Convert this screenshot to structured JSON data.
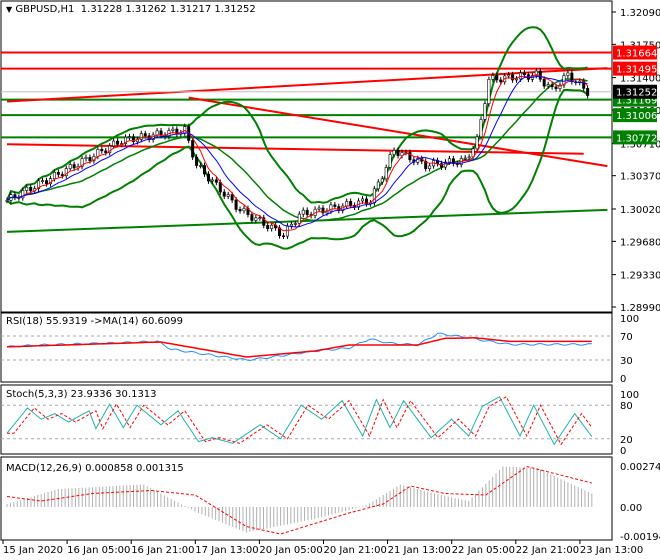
{
  "header": {
    "symbol": "GBPUSD,H1",
    "ohlc": "1.31228 1.31262 1.31217 1.31252"
  },
  "chart_data": {
    "type": "candlestick",
    "bars": 148,
    "price_axis": {
      "ticks": [
        "1.32090",
        "1.31750",
        "1.31400",
        "1.31060",
        "1.30710",
        "1.30370",
        "1.30020",
        "1.29680",
        "1.29330",
        "1.28990"
      ],
      "range": [
        1.2899,
        1.3209
      ]
    },
    "close_waypoints": [
      [
        0,
        1.3011
      ],
      [
        15,
        1.3043
      ],
      [
        29,
        1.3074
      ],
      [
        45,
        1.3085
      ],
      [
        48,
        1.3048
      ],
      [
        59,
        1.3001
      ],
      [
        70,
        1.2975
      ],
      [
        74,
        1.2996
      ],
      [
        92,
        1.3011
      ],
      [
        98,
        1.3064
      ],
      [
        106,
        1.3048
      ],
      [
        116,
        1.3053
      ],
      [
        119,
        1.3074
      ],
      [
        122,
        1.3138
      ],
      [
        134,
        1.3143
      ],
      [
        138,
        1.3127
      ],
      [
        142,
        1.3143
      ],
      [
        147,
        1.31252
      ]
    ],
    "levels": [
      {
        "price": "1.31664",
        "color": "#ff0000"
      },
      {
        "price": "1.31495",
        "color": "#ff0000"
      },
      {
        "price": "1.31169",
        "color": "#008000"
      },
      {
        "price": "1.31006",
        "color": "#008000"
      },
      {
        "price": "1.30772",
        "color": "#008000"
      }
    ],
    "current_price": "1.31252",
    "trendlines": [
      {
        "from": [
          0,
          1.3115
        ],
        "to": [
          152,
          1.315
        ],
        "color": "#ff0000"
      },
      {
        "from": [
          46,
          1.3119
        ],
        "to": [
          152,
          1.3047
        ],
        "color": "#ff0000"
      },
      {
        "from": [
          0,
          1.307
        ],
        "to": [
          146,
          1.306
        ],
        "color": "#ff0000"
      },
      {
        "from": [
          0,
          1.2978
        ],
        "to": [
          152,
          1.3001
        ],
        "color": "#008000"
      }
    ],
    "time_labels": [
      "15 Jan 2020",
      "16 Jan 05:00",
      "16 Jan 21:00",
      "17 Jan 13:00",
      "20 Jan 05:00",
      "20 Jan 21:00",
      "21 Jan 13:00",
      "22 Jan 05:00",
      "22 Jan 21:00",
      "23 Jan 13:00"
    ],
    "rsi": {
      "label": "RSI(18) 55.9319  ->MA(14) 60.6099",
      "ticks": [
        "100",
        "70",
        "30",
        "0"
      ],
      "waypoints": [
        [
          0,
          52
        ],
        [
          10,
          55
        ],
        [
          30,
          58
        ],
        [
          44,
          61
        ],
        [
          48,
          48
        ],
        [
          60,
          38
        ],
        [
          70,
          30
        ],
        [
          75,
          33
        ],
        [
          90,
          45
        ],
        [
          100,
          50
        ],
        [
          106,
          65
        ],
        [
          112,
          58
        ],
        [
          120,
          55
        ],
        [
          126,
          74
        ],
        [
          134,
          68
        ],
        [
          140,
          62
        ],
        [
          147,
          56
        ]
      ],
      "ma_waypoints": [
        [
          0,
          52
        ],
        [
          45,
          60
        ],
        [
          60,
          45
        ],
        [
          70,
          35
        ],
        [
          90,
          45
        ],
        [
          100,
          55
        ],
        [
          120,
          55
        ],
        [
          128,
          66
        ],
        [
          137,
          67
        ],
        [
          147,
          61
        ]
      ]
    },
    "stoch": {
      "label": "Stoch(5,3,3) 23.9336 30.1313",
      "ticks": [
        "100",
        "80",
        "20",
        "0"
      ],
      "waypoints": [
        [
          0,
          30
        ],
        [
          6,
          75
        ],
        [
          10,
          55
        ],
        [
          14,
          65
        ],
        [
          18,
          50
        ],
        [
          24,
          70
        ],
        [
          26,
          38
        ],
        [
          30,
          82
        ],
        [
          34,
          40
        ],
        [
          38,
          80
        ],
        [
          45,
          45
        ],
        [
          50,
          70
        ],
        [
          56,
          15
        ],
        [
          60,
          22
        ],
        [
          66,
          12
        ],
        [
          74,
          45
        ],
        [
          80,
          20
        ],
        [
          86,
          80
        ],
        [
          92,
          55
        ],
        [
          98,
          88
        ],
        [
          104,
          25
        ],
        [
          108,
          90
        ],
        [
          112,
          40
        ],
        [
          116,
          88
        ],
        [
          124,
          22
        ],
        [
          130,
          55
        ],
        [
          135,
          25
        ],
        [
          139,
          78
        ],
        [
          144,
          95
        ],
        [
          150,
          25
        ],
        [
          154,
          80
        ],
        [
          160,
          10
        ],
        [
          166,
          65
        ],
        [
          171,
          24
        ]
      ],
      "signal_lag": 2
    },
    "macd": {
      "label": "MACD(12,26,9) 0.000858 0.001315",
      "ticks": [
        "0.002745",
        "0.00",
        "-0.001945"
      ],
      "waypoints": [
        [
          0,
          0.0002
        ],
        [
          15,
          0.0012
        ],
        [
          40,
          0.0015
        ],
        [
          55,
          -0.0003
        ],
        [
          70,
          -0.0017
        ],
        [
          90,
          -0.0008
        ],
        [
          105,
          0.0001
        ],
        [
          115,
          0.0015
        ],
        [
          125,
          0.0009
        ],
        [
          135,
          0.0004
        ],
        [
          145,
          0.0027
        ],
        [
          155,
          0.0026
        ],
        [
          171,
          0.0009
        ]
      ],
      "signal_waypoints": [
        [
          0,
          0.0007
        ],
        [
          10,
          0.0004
        ],
        [
          25,
          0.0009
        ],
        [
          42,
          0.0011
        ],
        [
          55,
          0.0008
        ],
        [
          70,
          -0.0013
        ],
        [
          80,
          -0.0018
        ],
        [
          100,
          -0.0004
        ],
        [
          110,
          0.0002
        ],
        [
          118,
          0.0014
        ],
        [
          128,
          0.0009
        ],
        [
          140,
          0.0008
        ],
        [
          152,
          0.0027
        ],
        [
          171,
          0.0016
        ]
      ]
    }
  }
}
